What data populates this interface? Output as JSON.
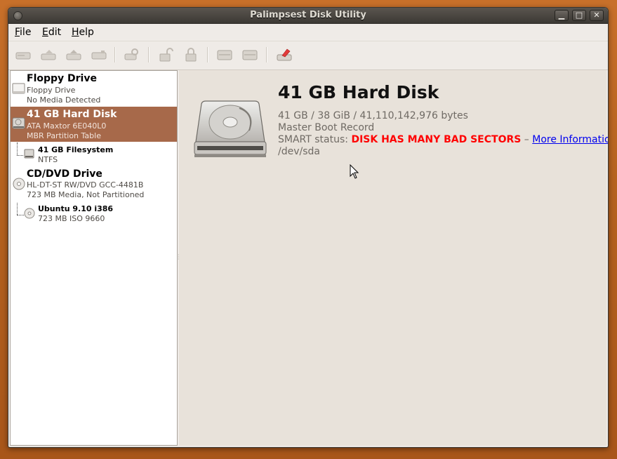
{
  "window": {
    "title": "Palimpsest Disk Utility"
  },
  "menu": {
    "file": "File",
    "file_rest": "ile",
    "file_u": "F",
    "edit_u": "E",
    "edit_rest": "dit",
    "help_u": "H",
    "help_rest": "elp"
  },
  "toolbar": {
    "icons": [
      "mount-icon",
      "unmount-icon",
      "eject-icon",
      "detach-icon",
      "check-filesystem-icon",
      "unlock-icon",
      "lock-icon",
      "create-partition-icon",
      "delete-partition-icon",
      "format-icon"
    ]
  },
  "sidebar": {
    "floppy": {
      "title": "Floppy Drive",
      "line1": "Floppy Drive",
      "line2": "No Media Detected"
    },
    "hdd": {
      "title": "41 GB Hard Disk",
      "line1": "ATA Maxtor 6E040L0",
      "line2": "MBR Partition Table"
    },
    "fs": {
      "title": "41 GB Filesystem",
      "line1": "NTFS"
    },
    "cdrom": {
      "title": "CD/DVD Drive",
      "line1": "HL-DT-ST RW/DVD GCC-4481B",
      "line2": "723 MB Media, Not Partitioned"
    },
    "ubuntu": {
      "title": "Ubuntu 9.10 i386",
      "line1": "723 MB ISO 9660"
    }
  },
  "details": {
    "title": "41 GB Hard Disk",
    "size": "41 GB / 38 GiB / 41,110,142,976 bytes",
    "scheme": "Master Boot Record",
    "smart_label": "SMART status: ",
    "smart_status": "DISK HAS MANY BAD SECTORS",
    "smart_sep": " – ",
    "more_info": "More Information",
    "device": "/dev/sda"
  },
  "colors": {
    "selection": "#a7694a",
    "smart_bad": "#ff0000",
    "link": "#0000ee"
  }
}
